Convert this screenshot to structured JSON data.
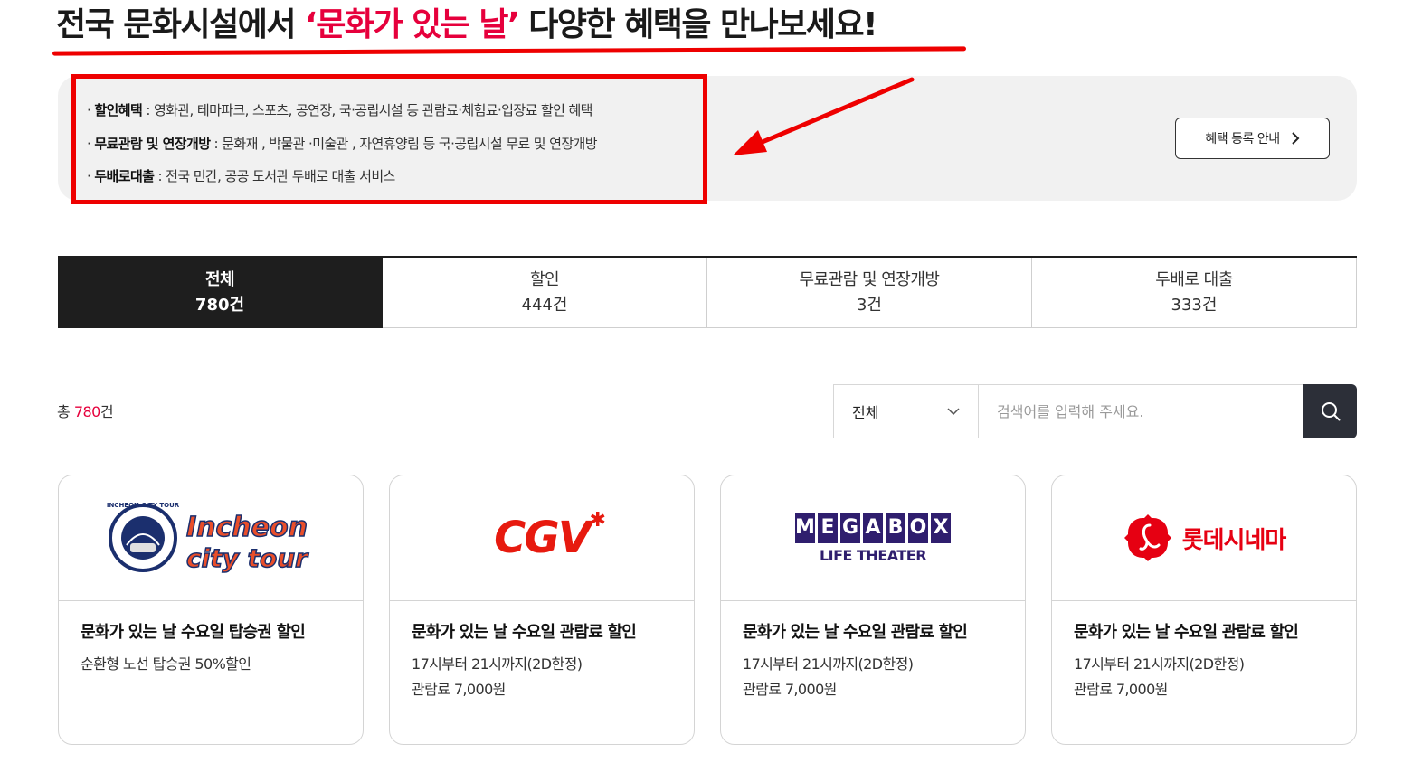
{
  "title": {
    "prefix": "전국 문화시설에서 ",
    "highlight": "‘문화가 있는 날’",
    "suffix": " 다양한 혜택을 만나보세요!"
  },
  "benefits": [
    {
      "term": "할인혜택",
      "desc": " : 영화관, 테마파크, 스포츠, 공연장, 국·공립시설 등 관람료·체험료·입장료 할인 혜택"
    },
    {
      "term": "무료관람 및 연장개방",
      "desc": " : 문화재 , 박물관 ·미술관 , 자연휴양림 등 국·공립시설 무료 및 연장개방"
    },
    {
      "term": "두배로대출",
      "desc": " : 전국 민간, 공공 도서관 두배로 대출 서비스"
    }
  ],
  "guide_button": "혜택 등록 안내",
  "tabs": [
    {
      "label": "전체",
      "count": "780건",
      "active": true
    },
    {
      "label": "할인",
      "count": "444건",
      "active": false
    },
    {
      "label": "무료관람 및 연장개방",
      "count": "3건",
      "active": false
    },
    {
      "label": "두배로 대출",
      "count": "333건",
      "active": false
    }
  ],
  "total": {
    "prefix": "총 ",
    "count": "780",
    "suffix": "건"
  },
  "search": {
    "select_value": "전체",
    "placeholder": "검색어를 입력해 주세요."
  },
  "cards": [
    {
      "logo": "Incheon city tour",
      "logo_line1": "Incheon",
      "logo_line2": "city tour",
      "badge_text": "INCHEON CITY TOUR",
      "title": "문화가 있는 날 수요일 탑승권 할인",
      "desc": "순환형 노선 탑승권 50%할인"
    },
    {
      "logo": "CGV",
      "logo_text": "CGV",
      "title": "문화가 있는 날 수요일 관람료 할인",
      "desc": "17시부터 21시까지(2D한정)\n관람료 7,000원"
    },
    {
      "logo": "MEGABOX LIFE THEATER",
      "logo_letters": [
        "M",
        "E",
        "G",
        "A",
        "B",
        "O",
        "X"
      ],
      "logo_sub": "LIFE THEATER",
      "title": "문화가 있는 날 수요일 관람료 할인",
      "desc": "17시부터 21시까지(2D한정)\n관람료 7,000원"
    },
    {
      "logo": "롯데시네마",
      "logo_text": "롯데시네마",
      "title": "문화가 있는 날 수요일 관람료 할인",
      "desc": "17시부터 21시까지(2D한정)\n관람료 7,000원"
    }
  ],
  "colors": {
    "accent": "#e6003c",
    "annotation_red": "#ee0000",
    "tab_active_bg": "#1e1e1e",
    "search_button_bg": "#2c2f38",
    "info_bg": "#f1f1f1"
  },
  "icons": {
    "guide_button": "chevron-right-icon",
    "select": "chevron-down-icon",
    "search_button": "search-icon"
  }
}
